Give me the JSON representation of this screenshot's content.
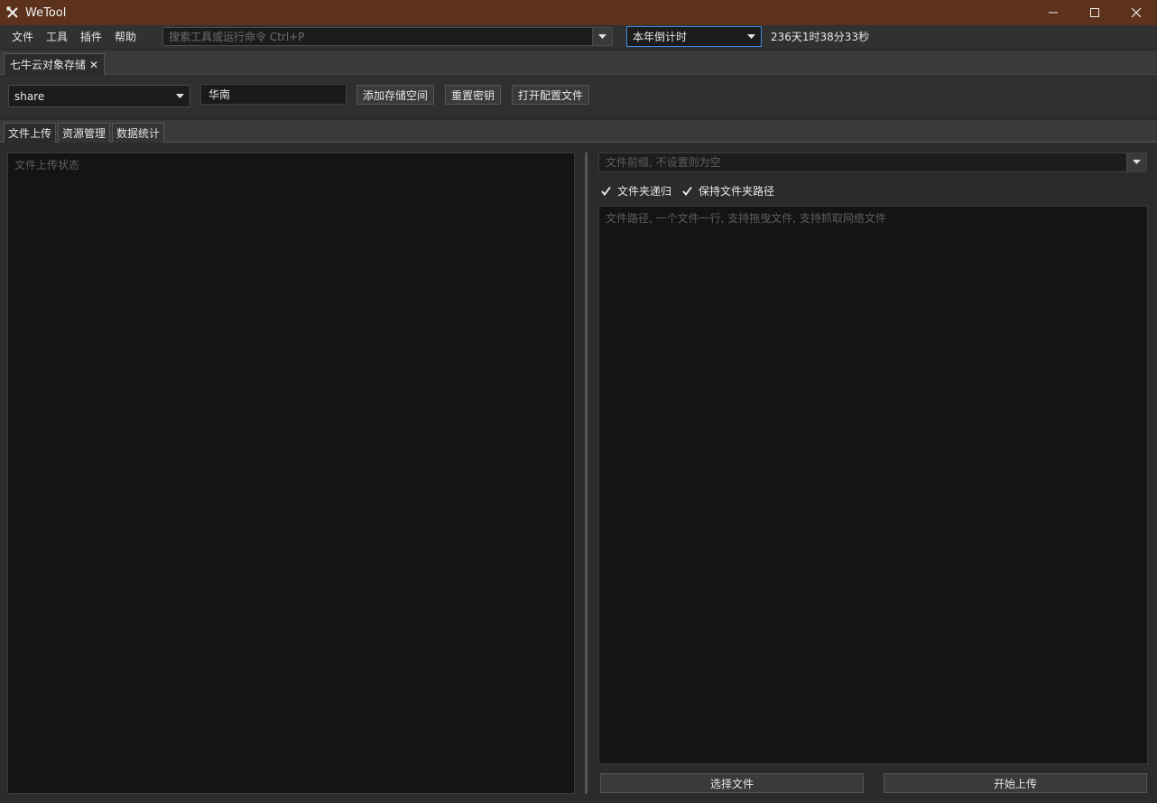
{
  "window": {
    "title": "WeTool",
    "icon": "tools-icon",
    "controls": [
      "minimize-icon",
      "maximize-icon",
      "close-icon"
    ]
  },
  "menu": {
    "items": [
      "文件",
      "工具",
      "插件",
      "帮助"
    ]
  },
  "search": {
    "placeholder": "搜索工具或运行命令 Ctrl+P"
  },
  "countdown": {
    "selected": "本年倒计时",
    "value": "236天1时38分33秒"
  },
  "plugin_tab": {
    "label": "七牛云对象存储"
  },
  "toolbar": {
    "bucket": "share",
    "region": "华南",
    "add_bucket": "添加存储空间",
    "reset_key": "重置密钥",
    "open_config": "打开配置文件"
  },
  "sub_tabs": [
    "文件上传",
    "资源管理",
    "数据统计"
  ],
  "upload": {
    "status_placeholder": "文件上传状态",
    "prefix_placeholder": "文件前缀, 不设置则为空",
    "recursive_label": "文件夹递归",
    "recursive_checked": true,
    "keep_path_label": "保持文件夹路径",
    "keep_path_checked": true,
    "paths_placeholder": "文件路径, 一个文件一行, 支持拖曳文件, 支持抓取网络文件",
    "select_files": "选择文件",
    "start_upload": "开始上传"
  },
  "colors": {
    "titlebar": "#5c321c",
    "focus_border": "#3a8ee6",
    "background": "#2b2b2b",
    "text_area": "#141414"
  }
}
